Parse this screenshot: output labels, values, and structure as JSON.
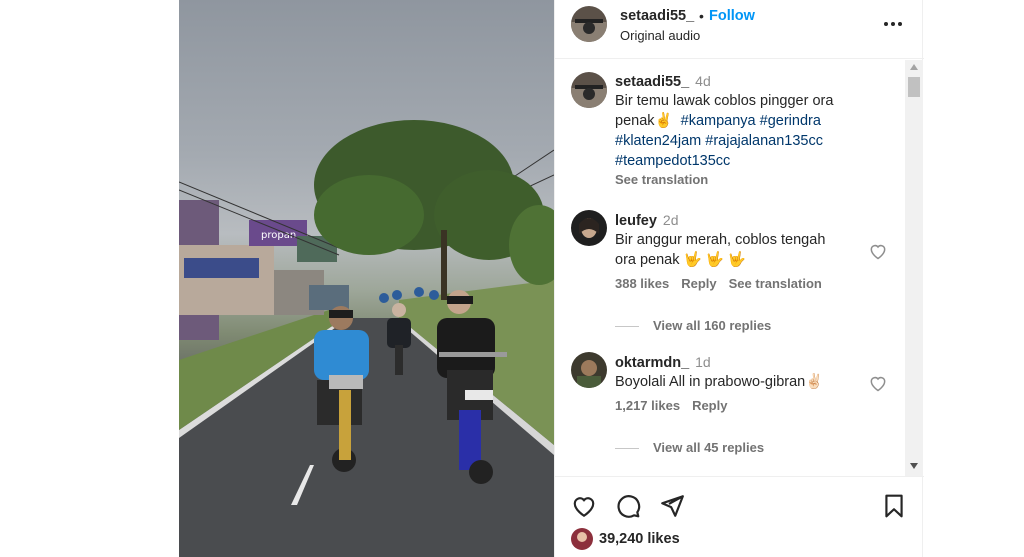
{
  "post": {
    "username": "setaadi55_",
    "follow_label": "Follow",
    "separator": "•",
    "audio": "Original audio"
  },
  "caption": {
    "username": "setaadi55_",
    "age": "4d",
    "line1": "Bir temu lawak coblos pingger ora",
    "line2_text": "penak",
    "line2_emoji": "✌️",
    "hashtags_line2": "#kampanya #gerindra",
    "hashtags_line3": "#klaten24jam #rajajalanan135cc",
    "hashtags_line4": "#teampedot135cc",
    "see_translation": "See translation"
  },
  "comments": [
    {
      "username": "leufey",
      "age": "2d",
      "line1": "Bir anggur merah, coblos tengah",
      "line2": "ora penak 🤟 🤟 🤟",
      "likes": "388 likes",
      "reply": "Reply",
      "see_translation": "See translation",
      "view_replies": "View all 160 replies"
    },
    {
      "username": "oktarmdn_",
      "age": "1d",
      "line1": "Boyolali All in prabowo-gibran✌🏻",
      "likes": "1,217 likes",
      "reply": "Reply",
      "view_replies": "View all 45 replies"
    }
  ],
  "footer": {
    "likes": "39,240 likes"
  },
  "icons": {
    "like": "heart-icon",
    "comment": "comment-icon",
    "share": "share-icon",
    "save": "bookmark-icon",
    "more": "more-options-icon"
  },
  "colors": {
    "follow": "#0095f6",
    "hashtag": "#00376b",
    "muted": "#737373"
  }
}
